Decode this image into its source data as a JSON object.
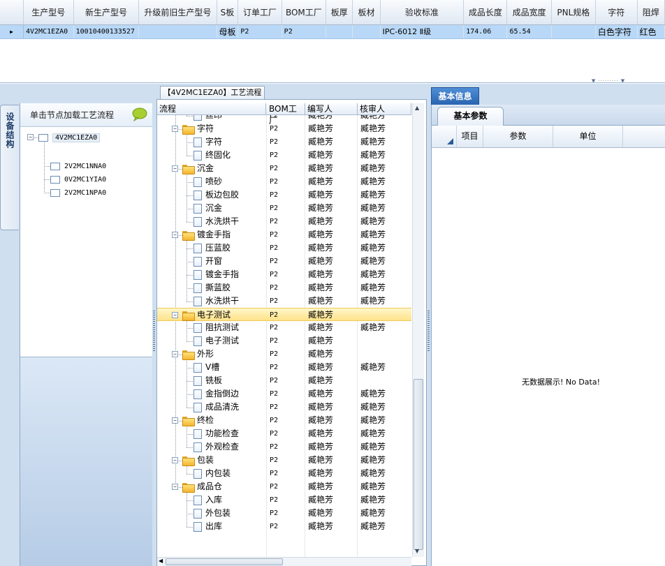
{
  "top_grid": {
    "columns": [
      "生产型号",
      "新生产型号",
      "升级前旧生产型号",
      "S板",
      "订单工厂",
      "BOM工厂",
      "板厚",
      "板材",
      "验收标准",
      "成品长度",
      "成品宽度",
      "PNL规格",
      "字符",
      "阻焊"
    ],
    "row": [
      "4V2MC1EZA0",
      "10010400133527",
      "",
      "母板",
      "P2",
      "P2",
      "",
      "",
      "IPC-6012 Ⅱ级",
      "174.06",
      "65.54",
      "",
      "白色字符",
      "红色"
    ],
    "row_indicator": "▶"
  },
  "left": {
    "vertical_tab_label": "设备结构",
    "panel_title": "单击节点加载工艺流程",
    "tree": {
      "root": "4V2MC1EZA0",
      "children": [
        "2V2MC1NNA0",
        "0V2MC1YIA0",
        "2V2MC1NPA0"
      ]
    }
  },
  "center": {
    "title": "【4V2MC1EZA0】工艺流程",
    "headers": {
      "flow": "流程",
      "bom": "BOM工厂",
      "author": "编写人",
      "reviewer": "核审人"
    },
    "rows": [
      {
        "name": "丝印",
        "bom": "P2",
        "author": "臧艳芳",
        "reviewer": "臧艳芳"
      },
      {
        "name": "字符",
        "bom": "P2",
        "author": "臧艳芳",
        "reviewer": "臧艳芳"
      },
      {
        "name": "字符",
        "bom": "P2",
        "author": "臧艳芳",
        "reviewer": "臧艳芳"
      },
      {
        "name": "终固化",
        "bom": "P2",
        "author": "臧艳芳",
        "reviewer": "臧艳芳"
      },
      {
        "name": "沉金",
        "bom": "P2",
        "author": "臧艳芳",
        "reviewer": "臧艳芳"
      },
      {
        "name": "喷砂",
        "bom": "P2",
        "author": "臧艳芳",
        "reviewer": "臧艳芳"
      },
      {
        "name": "板边包胶",
        "bom": "P2",
        "author": "臧艳芳",
        "reviewer": "臧艳芳"
      },
      {
        "name": "沉金",
        "bom": "P2",
        "author": "臧艳芳",
        "reviewer": "臧艳芳"
      },
      {
        "name": "水洗烘干",
        "bom": "P2",
        "author": "臧艳芳",
        "reviewer": "臧艳芳"
      },
      {
        "name": "镀金手指",
        "bom": "P2",
        "author": "臧艳芳",
        "reviewer": "臧艳芳"
      },
      {
        "name": "压蓝胶",
        "bom": "P2",
        "author": "臧艳芳",
        "reviewer": "臧艳芳"
      },
      {
        "name": "开窗",
        "bom": "P2",
        "author": "臧艳芳",
        "reviewer": "臧艳芳"
      },
      {
        "name": "镀金手指",
        "bom": "P2",
        "author": "臧艳芳",
        "reviewer": "臧艳芳"
      },
      {
        "name": "撕蓝胶",
        "bom": "P2",
        "author": "臧艳芳",
        "reviewer": "臧艳芳"
      },
      {
        "name": "水洗烘干",
        "bom": "P2",
        "author": "臧艳芳",
        "reviewer": "臧艳芳"
      },
      {
        "name": "电子测试",
        "bom": "P2",
        "author": "臧艳芳",
        "reviewer": ""
      },
      {
        "name": "阻抗测试",
        "bom": "P2",
        "author": "臧艳芳",
        "reviewer": "臧艳芳"
      },
      {
        "name": "电子测试",
        "bom": "P2",
        "author": "臧艳芳",
        "reviewer": ""
      },
      {
        "name": "外形",
        "bom": "P2",
        "author": "臧艳芳",
        "reviewer": ""
      },
      {
        "name": "V槽",
        "bom": "P2",
        "author": "臧艳芳",
        "reviewer": "臧艳芳"
      },
      {
        "name": "铣板",
        "bom": "P2",
        "author": "臧艳芳",
        "reviewer": ""
      },
      {
        "name": "金指倒边",
        "bom": "P2",
        "author": "臧艳芳",
        "reviewer": "臧艳芳"
      },
      {
        "name": "成品清洗",
        "bom": "P2",
        "author": "臧艳芳",
        "reviewer": "臧艳芳"
      },
      {
        "name": "终检",
        "bom": "P2",
        "author": "臧艳芳",
        "reviewer": "臧艳芳"
      },
      {
        "name": "功能检查",
        "bom": "P2",
        "author": "臧艳芳",
        "reviewer": "臧艳芳"
      },
      {
        "name": "外观检查",
        "bom": "P2",
        "author": "臧艳芳",
        "reviewer": "臧艳芳"
      },
      {
        "name": "包装",
        "bom": "P2",
        "author": "臧艳芳",
        "reviewer": "臧艳芳"
      },
      {
        "name": "内包装",
        "bom": "P2",
        "author": "臧艳芳",
        "reviewer": "臧艳芳"
      },
      {
        "name": "成品仓",
        "bom": "P2",
        "author": "臧艳芳",
        "reviewer": "臧艳芳"
      },
      {
        "name": "入库",
        "bom": "P2",
        "author": "臧艳芳",
        "reviewer": "臧艳芳"
      },
      {
        "name": "外包装",
        "bom": "P2",
        "author": "臧艳芳",
        "reviewer": "臧艳芳"
      },
      {
        "name": "出库",
        "bom": "P2",
        "author": "臧艳芳",
        "reviewer": "臧艳芳"
      }
    ]
  },
  "right": {
    "tab_label": "基本信息",
    "subtab_label": "基本参数",
    "columns": [
      "项目",
      "参数",
      "单位"
    ],
    "empty_message": "无数据展示! No Data!"
  },
  "colors": {
    "selected_row": "#b9d8f7",
    "highlight_row": "#ffe38a",
    "tab_active": "#2a63b0",
    "background": "#cfdff0"
  }
}
